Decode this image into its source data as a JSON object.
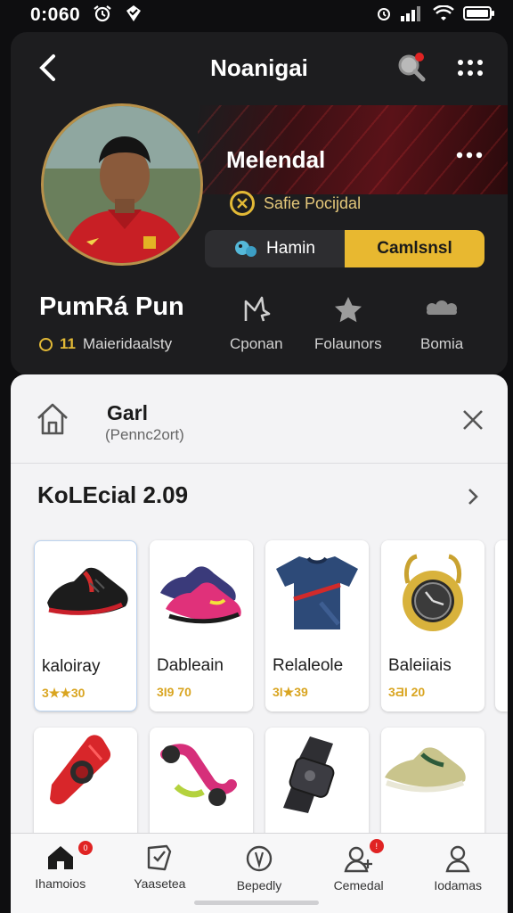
{
  "status": {
    "time": "0:060"
  },
  "header": {
    "title": "Noanigai"
  },
  "profile": {
    "name": "Melendal",
    "rank_label": "Safie Pocijdal",
    "toggle": [
      {
        "label": "Hamin",
        "active": false
      },
      {
        "label": "Camlsnsl",
        "active": true
      }
    ],
    "full_name": "PumRá Pun",
    "sub_number": "11",
    "sub_text": "Maieridaalsty",
    "stats": [
      {
        "label": "Cponan",
        "icon": "sparkle-icon"
      },
      {
        "label": "Folaunors",
        "icon": "star-icon"
      },
      {
        "label": "Bomia",
        "icon": "group-icon"
      }
    ]
  },
  "sheet": {
    "title": "Garl",
    "subtitle": "(Pennc2ort)",
    "section_title": "KoLEcial 2.09"
  },
  "products": [
    {
      "name": "kaloiray",
      "price": "3★★30",
      "icon": "sneaker-black-icon"
    },
    {
      "name": "Dableain",
      "price": "3I9 70",
      "icon": "sneaker-pink-icon"
    },
    {
      "name": "Relaleole",
      "price": "3I★39",
      "icon": "jersey-icon"
    },
    {
      "name": "Baleiiais",
      "price": "3ƋI 20",
      "icon": "pocket-watch-icon"
    }
  ],
  "products_row2": [
    {
      "icon": "red-gadget-icon"
    },
    {
      "icon": "pink-skate-icon"
    },
    {
      "icon": "smartwatch-icon"
    },
    {
      "icon": "sneaker-olive-icon"
    }
  ],
  "nav": [
    {
      "label": "Ihamoios",
      "icon": "home-icon",
      "badge": "0"
    },
    {
      "label": "Yaasetea",
      "icon": "shield-check-icon",
      "badge": ""
    },
    {
      "label": "Bepedly",
      "icon": "compass-icon",
      "badge": ""
    },
    {
      "label": "Cemedal",
      "icon": "people-icon",
      "badge": "!"
    },
    {
      "label": "Iodamas",
      "icon": "person-icon",
      "badge": ""
    }
  ],
  "colors": {
    "accent": "#E8B830",
    "badge": "#E02323",
    "card_bg": "#1D1D1F",
    "sheet_bg": "#F3F3F5"
  }
}
